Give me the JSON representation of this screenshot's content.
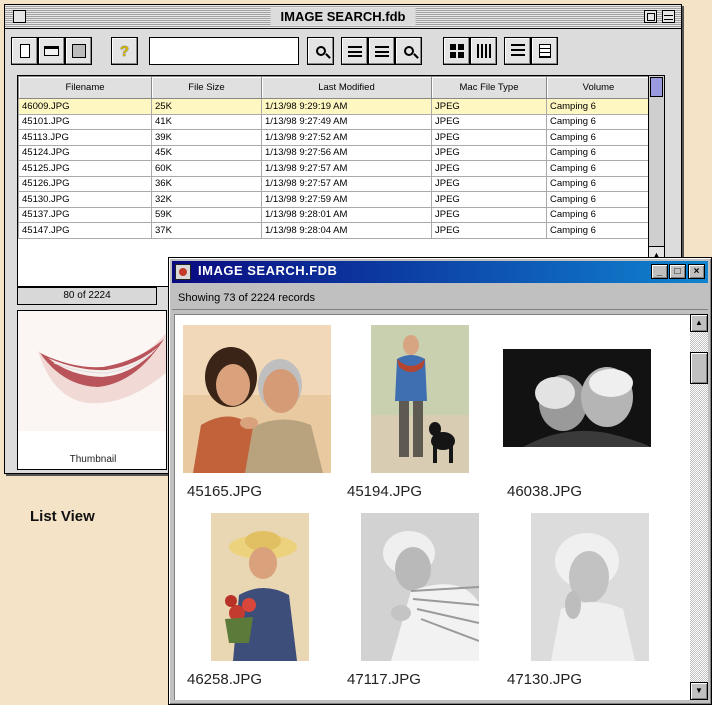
{
  "list_window": {
    "title": "IMAGE SEARCH.fdb",
    "search_value": "",
    "columns": [
      "Filename",
      "File Size",
      "Last Modified",
      "Mac File Type",
      "Volume"
    ],
    "rows": [
      [
        "46009.JPG",
        "25K",
        "1/13/98 9:29:19 AM",
        "JPEG",
        "Camping 6"
      ],
      [
        "45101.JPG",
        "41K",
        "1/13/98 9:27:49 AM",
        "JPEG",
        "Camping 6"
      ],
      [
        "45113.JPG",
        "39K",
        "1/13/98 9:27:52 AM",
        "JPEG",
        "Camping 6"
      ],
      [
        "45124.JPG",
        "45K",
        "1/13/98 9:27:56 AM",
        "JPEG",
        "Camping 6"
      ],
      [
        "45125.JPG",
        "60K",
        "1/13/98 9:27:57 AM",
        "JPEG",
        "Camping 6"
      ],
      [
        "45126.JPG",
        "36K",
        "1/13/98 9:27:57 AM",
        "JPEG",
        "Camping 6"
      ],
      [
        "45130.JPG",
        "32K",
        "1/13/98 9:27:59 AM",
        "JPEG",
        "Camping 6"
      ],
      [
        "45137.JPG",
        "59K",
        "1/13/98 9:28:01 AM",
        "JPEG",
        "Camping 6"
      ],
      [
        "45147.JPG",
        "37K",
        "1/13/98 9:28:04 AM",
        "JPEG",
        "Camping 6"
      ]
    ],
    "status": "80 of 2224",
    "thumbnail_label": "Thumbnail"
  },
  "caption": "List View",
  "thumb_window": {
    "title": "IMAGE SEARCH.FDB",
    "status": "Showing 73 of 2224 records",
    "controls": [
      "_",
      "□",
      "×"
    ],
    "tiles": [
      {
        "filename": "45165.JPG"
      },
      {
        "filename": "45194.JPG"
      },
      {
        "filename": "46038.JPG"
      },
      {
        "filename": "46258.JPG"
      },
      {
        "filename": "47117.JPG"
      },
      {
        "filename": "47130.JPG"
      }
    ]
  },
  "icons": {
    "toolbar": [
      "new-document-icon",
      "open-folder-icon",
      "save-icon",
      "help-icon",
      "search-icon",
      "previous-record-icon",
      "next-record-icon",
      "find-icon",
      "thumbnail-view-icon",
      "column-view-icon",
      "list-view-icon",
      "form-view-icon"
    ]
  },
  "colors": {
    "selected_row": "#fff7c2",
    "win_title_start": "#0a0a80",
    "win_title_end": "#1084d0",
    "background": "#f5e3c8"
  }
}
